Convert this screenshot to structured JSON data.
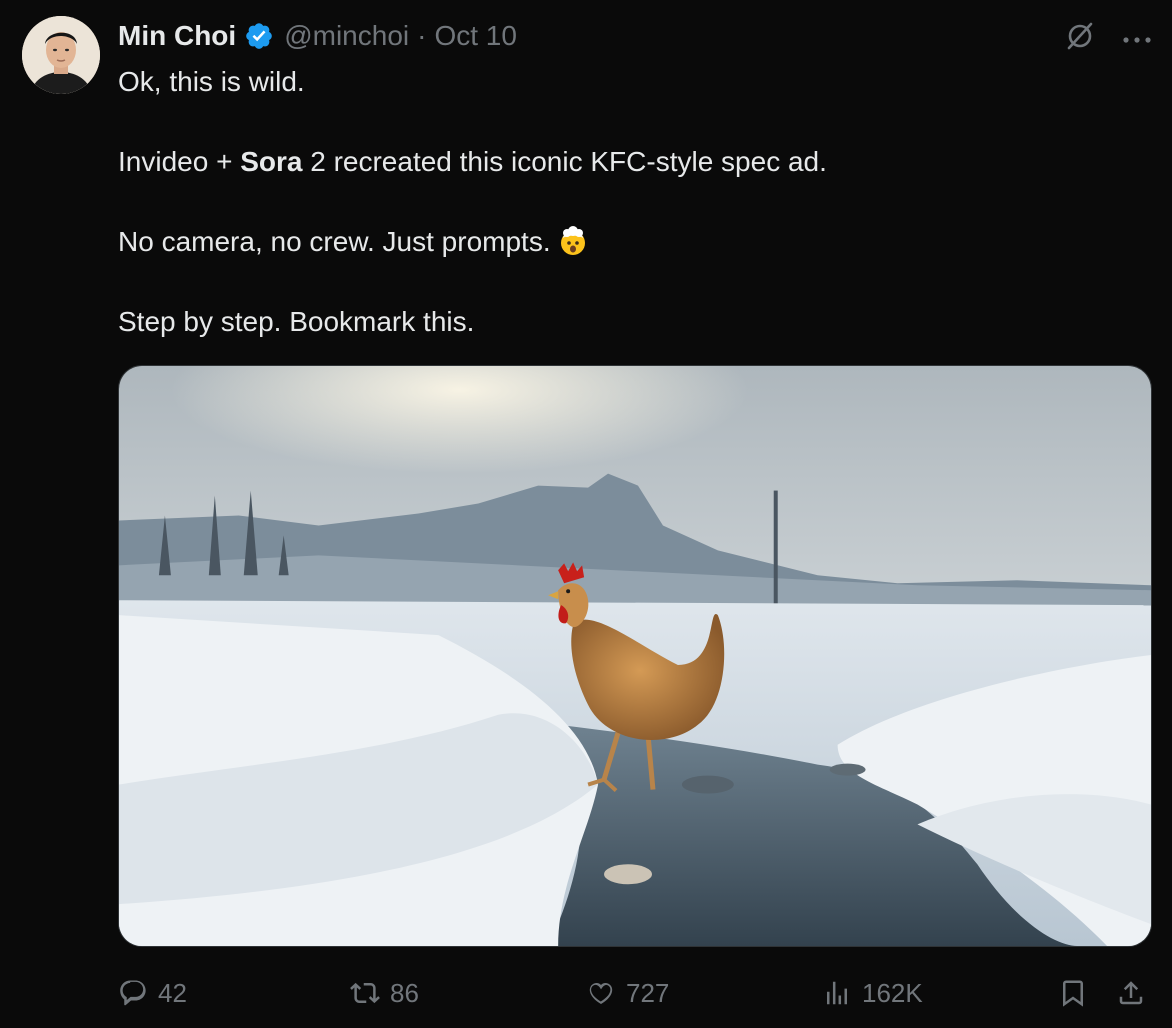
{
  "author": {
    "name": "Min Choi",
    "handle": "@minchoi",
    "separator": "·",
    "date": "Oct 10",
    "verified_color": "#1d9bf0"
  },
  "tweet": {
    "line1": "Ok, this is wild.",
    "line2_before": "Invideo + ",
    "line2_bold": "Sora",
    "line2_after": " 2 recreated this iconic KFC-style spec ad.",
    "line3": "No camera, no crew. Just prompts.",
    "line3_emoji": "exploding-head-emoji",
    "line4": "Step by step.  Bookmark this."
  },
  "media": {
    "type": "video-thumbnail",
    "scene": "chicken-walking-on-snowy-stream"
  },
  "actions": {
    "replies": "42",
    "reposts": "86",
    "likes": "727",
    "views": "162K"
  },
  "icons": {
    "grok": "grok-icon",
    "more": "more-icon",
    "reply": "reply-icon",
    "repost": "repost-icon",
    "like": "heart-icon",
    "views": "views-icon",
    "bookmark": "bookmark-icon",
    "share": "share-icon"
  },
  "colors": {
    "background": "#0a0a0a",
    "text": "#e7e9ea",
    "muted": "#71767b"
  }
}
